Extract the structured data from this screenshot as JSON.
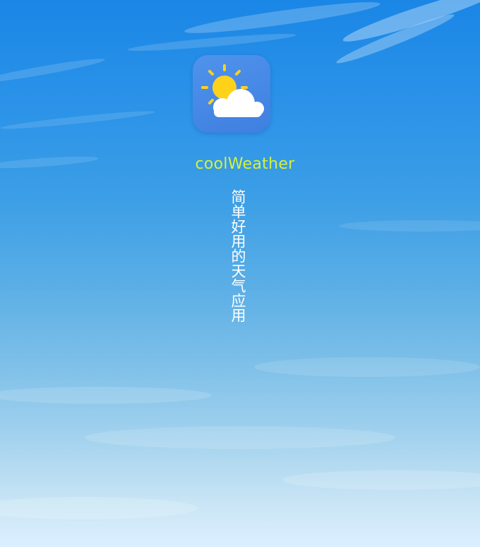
{
  "app": {
    "name": "coolWeather",
    "slogan": "简单好用的天气应用",
    "icon": "sun-behind-cloud-icon"
  },
  "colors": {
    "sky_top": "#1a86e6",
    "sky_bottom": "#dcefff",
    "icon_bg": "#4a8be8",
    "app_name": "#d4f23a",
    "slogan": "#ffffff",
    "sun": "#ffd21a"
  }
}
